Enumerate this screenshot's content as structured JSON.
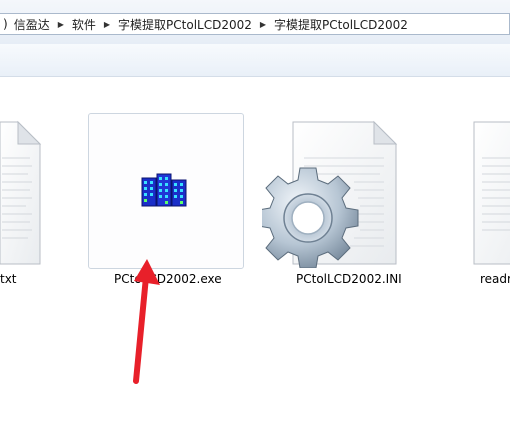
{
  "breadcrumb": {
    "prefix": ")",
    "items": [
      "信盈达",
      "软件",
      "字模提取PCtolLCD2002",
      "字模提取PCtolLCD2002"
    ]
  },
  "files": [
    {
      "label": "txt",
      "icon": "text-document-icon"
    },
    {
      "label": "PCtoLCD2002.exe",
      "icon": "application-exe-icon"
    },
    {
      "label": "PCtolLCD2002.INI",
      "icon": "settings-gear-icon"
    },
    {
      "label": "readr",
      "icon": "text-document-icon"
    }
  ],
  "colors": {
    "arrow": "#e8202a",
    "building": "#1a2ec8"
  }
}
